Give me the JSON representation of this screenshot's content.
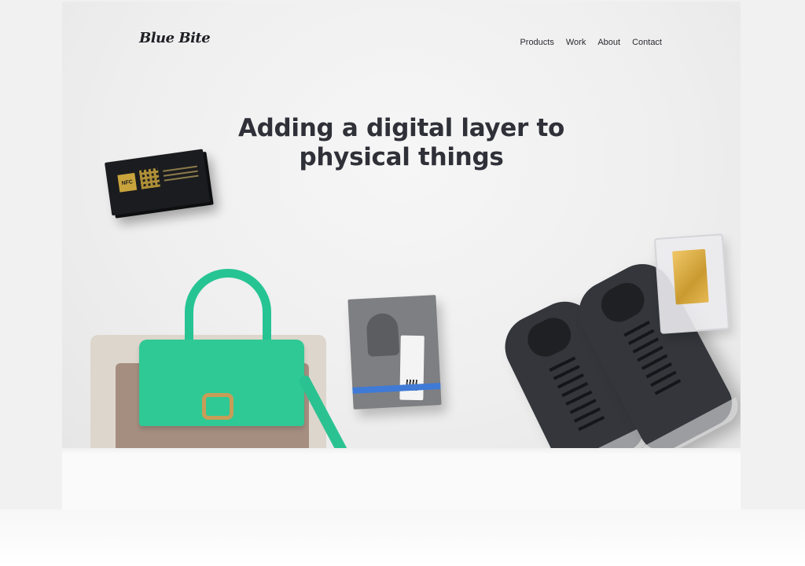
{
  "header": {
    "logo": "Blue Bite",
    "nav": [
      "Products",
      "Work",
      "About",
      "Contact"
    ]
  },
  "hero": {
    "headline_line1": "Adding a digital layer to",
    "headline_line2": "physical things"
  },
  "card": {
    "chip_label": "NFC"
  },
  "colors": {
    "accent_green": "#2fc995",
    "text_dark": "#2f3038",
    "background": "#f2f1f2"
  }
}
